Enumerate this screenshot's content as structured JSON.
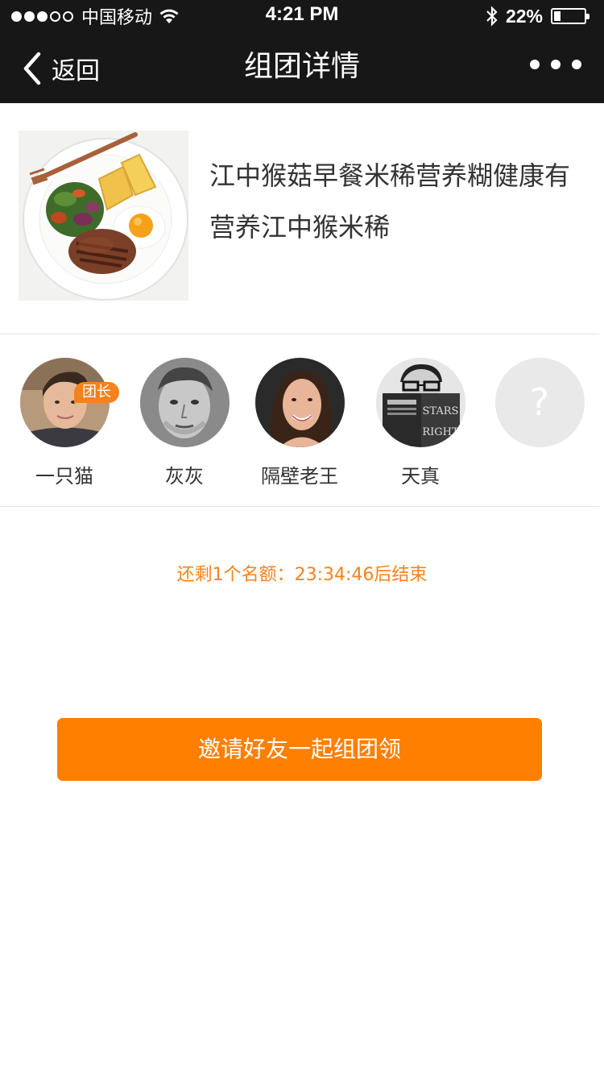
{
  "status_bar": {
    "carrier": "中国移动",
    "time": "4:21 PM",
    "battery": "22%",
    "battery_level": 0.22,
    "signal_bars": 3
  },
  "nav": {
    "back_label": "返回",
    "title": "组团详情",
    "more_icon": "more-dots-icon"
  },
  "product": {
    "title": "江中猴菇早餐米稀营养糊健康有营养江中猴米稀",
    "image": "breakfast-plate-image"
  },
  "members": [
    {
      "name": "一只猫",
      "badge": "团长"
    },
    {
      "name": "灰灰"
    },
    {
      "name": "隔壁老王"
    },
    {
      "name": "天真"
    }
  ],
  "empty_slot": {
    "symbol": "?"
  },
  "countdown": "还剩1个名额：23:34:46后结束",
  "invite_button": "邀请好友一起组团领",
  "colors": {
    "accent": "#ff7f00",
    "nav_bg": "#171717",
    "countdown_text": "#f5821f"
  }
}
